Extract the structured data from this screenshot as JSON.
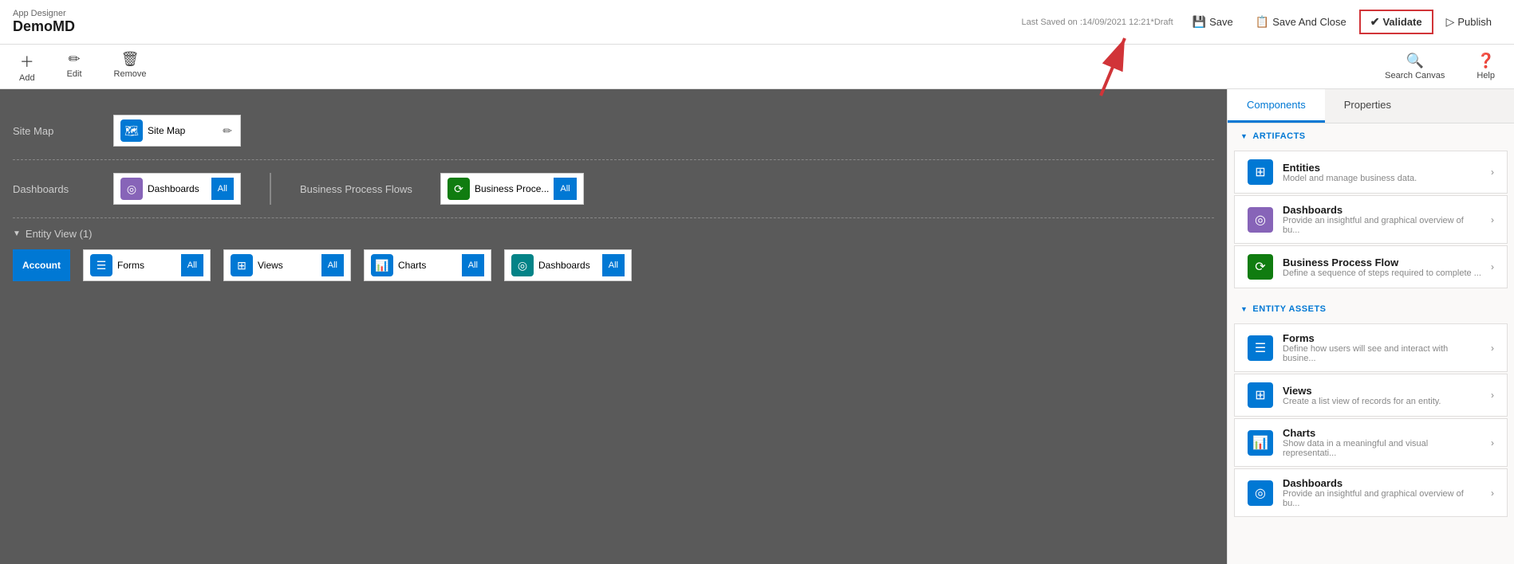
{
  "app": {
    "designer_label": "App Designer",
    "app_name": "DemoMD",
    "last_saved": "Last Saved on :14/09/2021 12:21",
    "draft_label": "*Draft"
  },
  "toolbar": {
    "save_label": "Save",
    "save_close_label": "Save And Close",
    "validate_label": "Validate",
    "publish_label": "Publish",
    "add_label": "Add",
    "edit_label": "Edit",
    "remove_label": "Remove",
    "search_canvas_label": "Search Canvas",
    "help_label": "Help"
  },
  "canvas": {
    "site_map_row": {
      "label": "Site Map",
      "item_label": "Site Map"
    },
    "dashboards_row": {
      "label": "Dashboards",
      "item_label": "Dashboards",
      "all_label": "All",
      "bpf_section_label": "Business Process Flows",
      "bpf_item_label": "Business Proce...",
      "bpf_all_label": "All"
    },
    "entity_view": {
      "header": "Entity View (1)",
      "account_label": "Account",
      "forms_label": "Forms",
      "forms_all": "All",
      "views_label": "Views",
      "views_all": "All",
      "charts_label": "Charts",
      "charts_all": "All",
      "dashboards_label": "Dashboards",
      "dashboards_all": "All"
    }
  },
  "right_panel": {
    "components_tab": "Components",
    "properties_tab": "Properties",
    "artifacts_header": "ARTIFACTS",
    "entity_assets_header": "ENTITY ASSETS",
    "artifacts": [
      {
        "id": "entities",
        "title": "Entities",
        "description": "Model and manage business data.",
        "icon_color": "#0078d4",
        "icon": "⊞"
      },
      {
        "id": "dashboards",
        "title": "Dashboards",
        "description": "Provide an insightful and graphical overview of bu...",
        "icon_color": "#8764b8",
        "icon": "◎"
      },
      {
        "id": "bpf",
        "title": "Business Process Flow",
        "description": "Define a sequence of steps required to complete ...",
        "icon_color": "#107c10",
        "icon": "⟳"
      }
    ],
    "entity_assets": [
      {
        "id": "forms",
        "title": "Forms",
        "description": "Define how users will see and interact with busine...",
        "icon_color": "#0078d4",
        "icon": "☰"
      },
      {
        "id": "views",
        "title": "Views",
        "description": "Create a list view of records for an entity.",
        "icon_color": "#0078d4",
        "icon": "⊞"
      },
      {
        "id": "charts",
        "title": "Charts",
        "description": "Show data in a meaningful and visual representati...",
        "icon_color": "#0078d4",
        "icon": "📊"
      },
      {
        "id": "dashboards2",
        "title": "Dashboards",
        "description": "Provide an insightful and graphical overview of bu...",
        "icon_color": "#0078d4",
        "icon": "◎"
      }
    ]
  }
}
